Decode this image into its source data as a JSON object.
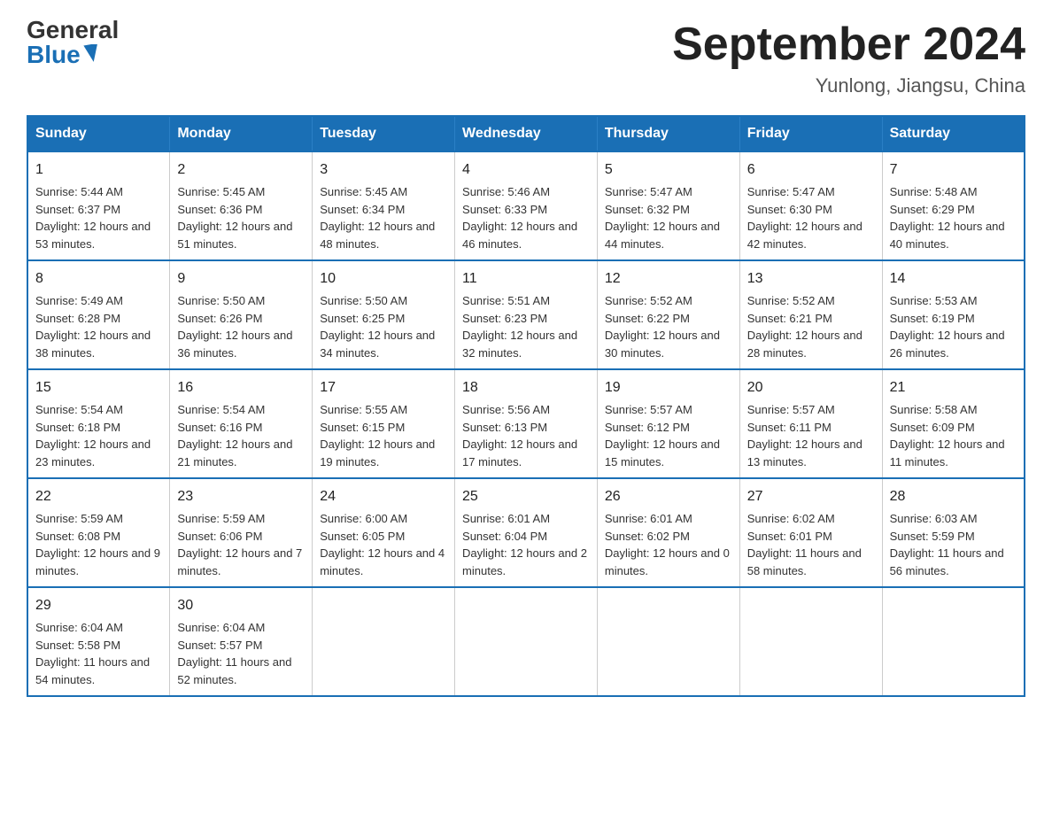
{
  "header": {
    "logo": {
      "general_text": "General",
      "blue_text": "Blue"
    },
    "title": "September 2024",
    "subtitle": "Yunlong, Jiangsu, China"
  },
  "calendar": {
    "days_of_week": [
      "Sunday",
      "Monday",
      "Tuesday",
      "Wednesday",
      "Thursday",
      "Friday",
      "Saturday"
    ],
    "weeks": [
      [
        {
          "day": "1",
          "sunrise": "Sunrise: 5:44 AM",
          "sunset": "Sunset: 6:37 PM",
          "daylight": "Daylight: 12 hours and 53 minutes."
        },
        {
          "day": "2",
          "sunrise": "Sunrise: 5:45 AM",
          "sunset": "Sunset: 6:36 PM",
          "daylight": "Daylight: 12 hours and 51 minutes."
        },
        {
          "day": "3",
          "sunrise": "Sunrise: 5:45 AM",
          "sunset": "Sunset: 6:34 PM",
          "daylight": "Daylight: 12 hours and 48 minutes."
        },
        {
          "day": "4",
          "sunrise": "Sunrise: 5:46 AM",
          "sunset": "Sunset: 6:33 PM",
          "daylight": "Daylight: 12 hours and 46 minutes."
        },
        {
          "day": "5",
          "sunrise": "Sunrise: 5:47 AM",
          "sunset": "Sunset: 6:32 PM",
          "daylight": "Daylight: 12 hours and 44 minutes."
        },
        {
          "day": "6",
          "sunrise": "Sunrise: 5:47 AM",
          "sunset": "Sunset: 6:30 PM",
          "daylight": "Daylight: 12 hours and 42 minutes."
        },
        {
          "day": "7",
          "sunrise": "Sunrise: 5:48 AM",
          "sunset": "Sunset: 6:29 PM",
          "daylight": "Daylight: 12 hours and 40 minutes."
        }
      ],
      [
        {
          "day": "8",
          "sunrise": "Sunrise: 5:49 AM",
          "sunset": "Sunset: 6:28 PM",
          "daylight": "Daylight: 12 hours and 38 minutes."
        },
        {
          "day": "9",
          "sunrise": "Sunrise: 5:50 AM",
          "sunset": "Sunset: 6:26 PM",
          "daylight": "Daylight: 12 hours and 36 minutes."
        },
        {
          "day": "10",
          "sunrise": "Sunrise: 5:50 AM",
          "sunset": "Sunset: 6:25 PM",
          "daylight": "Daylight: 12 hours and 34 minutes."
        },
        {
          "day": "11",
          "sunrise": "Sunrise: 5:51 AM",
          "sunset": "Sunset: 6:23 PM",
          "daylight": "Daylight: 12 hours and 32 minutes."
        },
        {
          "day": "12",
          "sunrise": "Sunrise: 5:52 AM",
          "sunset": "Sunset: 6:22 PM",
          "daylight": "Daylight: 12 hours and 30 minutes."
        },
        {
          "day": "13",
          "sunrise": "Sunrise: 5:52 AM",
          "sunset": "Sunset: 6:21 PM",
          "daylight": "Daylight: 12 hours and 28 minutes."
        },
        {
          "day": "14",
          "sunrise": "Sunrise: 5:53 AM",
          "sunset": "Sunset: 6:19 PM",
          "daylight": "Daylight: 12 hours and 26 minutes."
        }
      ],
      [
        {
          "day": "15",
          "sunrise": "Sunrise: 5:54 AM",
          "sunset": "Sunset: 6:18 PM",
          "daylight": "Daylight: 12 hours and 23 minutes."
        },
        {
          "day": "16",
          "sunrise": "Sunrise: 5:54 AM",
          "sunset": "Sunset: 6:16 PM",
          "daylight": "Daylight: 12 hours and 21 minutes."
        },
        {
          "day": "17",
          "sunrise": "Sunrise: 5:55 AM",
          "sunset": "Sunset: 6:15 PM",
          "daylight": "Daylight: 12 hours and 19 minutes."
        },
        {
          "day": "18",
          "sunrise": "Sunrise: 5:56 AM",
          "sunset": "Sunset: 6:13 PM",
          "daylight": "Daylight: 12 hours and 17 minutes."
        },
        {
          "day": "19",
          "sunrise": "Sunrise: 5:57 AM",
          "sunset": "Sunset: 6:12 PM",
          "daylight": "Daylight: 12 hours and 15 minutes."
        },
        {
          "day": "20",
          "sunrise": "Sunrise: 5:57 AM",
          "sunset": "Sunset: 6:11 PM",
          "daylight": "Daylight: 12 hours and 13 minutes."
        },
        {
          "day": "21",
          "sunrise": "Sunrise: 5:58 AM",
          "sunset": "Sunset: 6:09 PM",
          "daylight": "Daylight: 12 hours and 11 minutes."
        }
      ],
      [
        {
          "day": "22",
          "sunrise": "Sunrise: 5:59 AM",
          "sunset": "Sunset: 6:08 PM",
          "daylight": "Daylight: 12 hours and 9 minutes."
        },
        {
          "day": "23",
          "sunrise": "Sunrise: 5:59 AM",
          "sunset": "Sunset: 6:06 PM",
          "daylight": "Daylight: 12 hours and 7 minutes."
        },
        {
          "day": "24",
          "sunrise": "Sunrise: 6:00 AM",
          "sunset": "Sunset: 6:05 PM",
          "daylight": "Daylight: 12 hours and 4 minutes."
        },
        {
          "day": "25",
          "sunrise": "Sunrise: 6:01 AM",
          "sunset": "Sunset: 6:04 PM",
          "daylight": "Daylight: 12 hours and 2 minutes."
        },
        {
          "day": "26",
          "sunrise": "Sunrise: 6:01 AM",
          "sunset": "Sunset: 6:02 PM",
          "daylight": "Daylight: 12 hours and 0 minutes."
        },
        {
          "day": "27",
          "sunrise": "Sunrise: 6:02 AM",
          "sunset": "Sunset: 6:01 PM",
          "daylight": "Daylight: 11 hours and 58 minutes."
        },
        {
          "day": "28",
          "sunrise": "Sunrise: 6:03 AM",
          "sunset": "Sunset: 5:59 PM",
          "daylight": "Daylight: 11 hours and 56 minutes."
        }
      ],
      [
        {
          "day": "29",
          "sunrise": "Sunrise: 6:04 AM",
          "sunset": "Sunset: 5:58 PM",
          "daylight": "Daylight: 11 hours and 54 minutes."
        },
        {
          "day": "30",
          "sunrise": "Sunrise: 6:04 AM",
          "sunset": "Sunset: 5:57 PM",
          "daylight": "Daylight: 11 hours and 52 minutes."
        },
        null,
        null,
        null,
        null,
        null
      ]
    ]
  }
}
